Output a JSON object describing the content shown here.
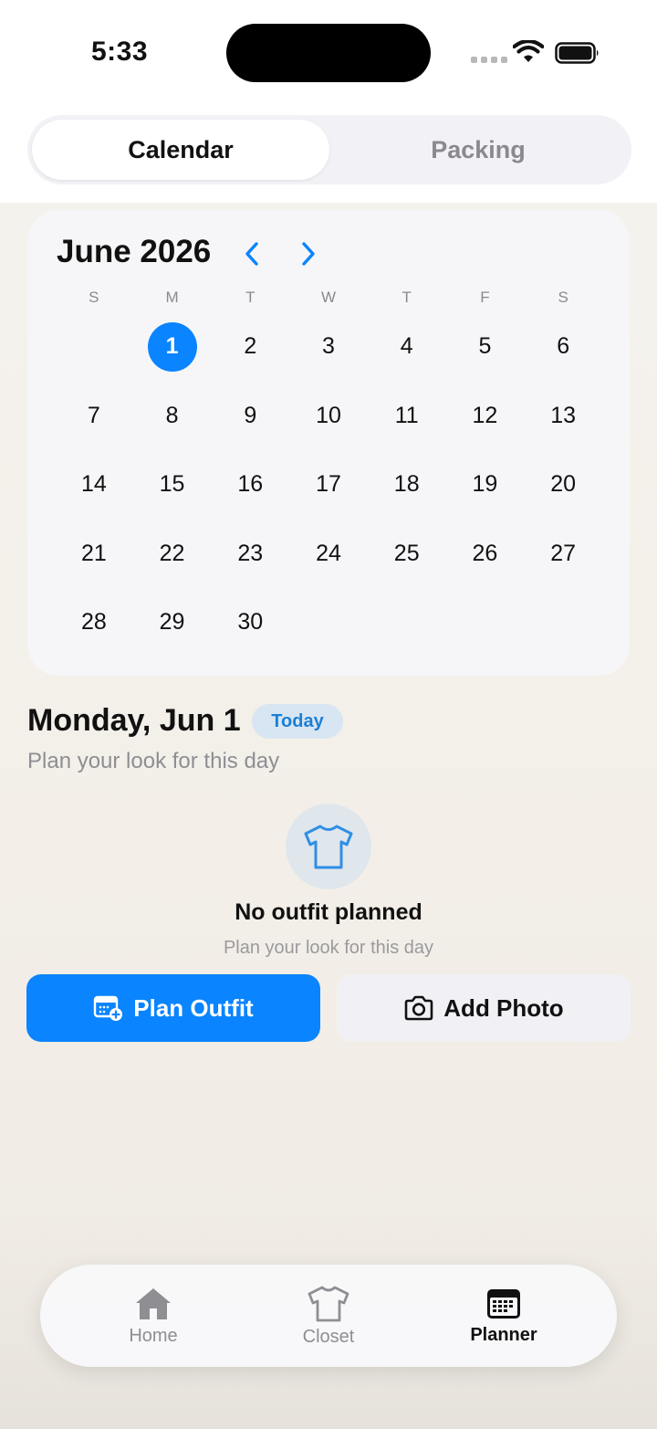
{
  "status_bar": {
    "time": "5:33"
  },
  "segmented": {
    "calendar": "Calendar",
    "packing": "Packing",
    "selected": "Calendar"
  },
  "calendar": {
    "month_title": "June 2026",
    "weekdays": [
      "S",
      "M",
      "T",
      "W",
      "T",
      "F",
      "S"
    ],
    "selected_day": "1",
    "days": [
      [
        "",
        "1",
        "2",
        "3",
        "4",
        "5",
        "6"
      ],
      [
        "7",
        "8",
        "9",
        "10",
        "11",
        "12",
        "13"
      ],
      [
        "14",
        "15",
        "16",
        "17",
        "18",
        "19",
        "20"
      ],
      [
        "21",
        "22",
        "23",
        "24",
        "25",
        "26",
        "27"
      ],
      [
        "28",
        "29",
        "30",
        "",
        "",
        "",
        ""
      ]
    ]
  },
  "day_detail": {
    "title": "Monday, Jun 1",
    "badge": "Today",
    "subtitle": "Plan your look for this day",
    "empty_title": "No outfit planned",
    "empty_subtitle": "Plan your look for this day"
  },
  "actions": {
    "plan_outfit": "Plan Outfit",
    "add_photo": "Add Photo"
  },
  "tab_bar": {
    "home": "Home",
    "closet": "Closet",
    "planner": "Planner",
    "active": "Planner"
  },
  "colors": {
    "accent": "#0a84ff",
    "badge_bg": "#d8e6f3",
    "badge_text": "#1b7fd6"
  },
  "icons": {
    "prev": "chevron-left-icon",
    "next": "chevron-right-icon",
    "empty": "tshirt-icon",
    "plan": "calendar-plus-icon",
    "photo": "camera-icon",
    "tab_home": "house-icon",
    "tab_closet": "tshirt-icon",
    "tab_planner": "calendar-icon"
  }
}
